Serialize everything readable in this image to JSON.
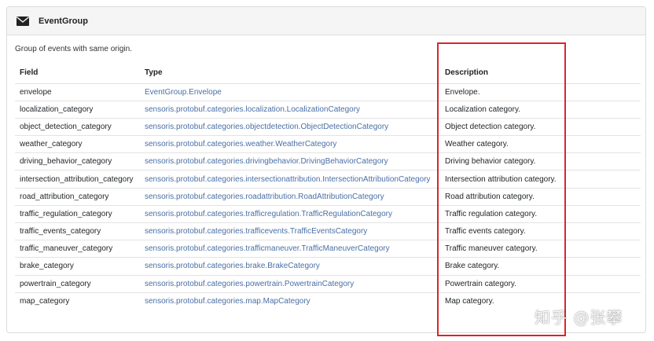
{
  "panel": {
    "title": "EventGroup",
    "icon": "envelope-icon",
    "description": "Group of events with same origin."
  },
  "table": {
    "headers": [
      "Field",
      "Type",
      "Description"
    ],
    "rows": [
      {
        "field": "envelope",
        "type": "EventGroup.Envelope",
        "description": "Envelope."
      },
      {
        "field": "localization_category",
        "type": "sensoris.protobuf.categories.localization.LocalizationCategory",
        "description": "Localization category."
      },
      {
        "field": "object_detection_category",
        "type": "sensoris.protobuf.categories.objectdetection.ObjectDetectionCategory",
        "description": "Object detection category."
      },
      {
        "field": "weather_category",
        "type": "sensoris.protobuf.categories.weather.WeatherCategory",
        "description": "Weather category."
      },
      {
        "field": "driving_behavior_category",
        "type": "sensoris.protobuf.categories.drivingbehavior.DrivingBehaviorCategory",
        "description": "Driving behavior category."
      },
      {
        "field": "intersection_attribution_category",
        "type": "sensoris.protobuf.categories.intersectionattribution.IntersectionAttributionCategory",
        "description": "Intersection attribution category."
      },
      {
        "field": "road_attribution_category",
        "type": "sensoris.protobuf.categories.roadattribution.RoadAttributionCategory",
        "description": "Road attribution category."
      },
      {
        "field": "traffic_regulation_category",
        "type": "sensoris.protobuf.categories.trafficregulation.TrafficRegulationCategory",
        "description": "Traffic regulation category."
      },
      {
        "field": "traffic_events_category",
        "type": "sensoris.protobuf.categories.trafficevents.TrafficEventsCategory",
        "description": "Traffic events category."
      },
      {
        "field": "traffic_maneuver_category",
        "type": "sensoris.protobuf.categories.trafficmaneuver.TrafficManeuverCategory",
        "description": "Traffic maneuver category."
      },
      {
        "field": "brake_category",
        "type": "sensoris.protobuf.categories.brake.BrakeCategory",
        "description": "Brake category."
      },
      {
        "field": "powertrain_category",
        "type": "sensoris.protobuf.categories.powertrain.PowertrainCategory",
        "description": "Powertrain category."
      },
      {
        "field": "map_category",
        "type": "sensoris.protobuf.categories.map.MapCategory",
        "description": "Map category."
      }
    ]
  },
  "annotation": {
    "highlight_color": "#d9262c"
  },
  "watermark": "知乎 @张攀"
}
